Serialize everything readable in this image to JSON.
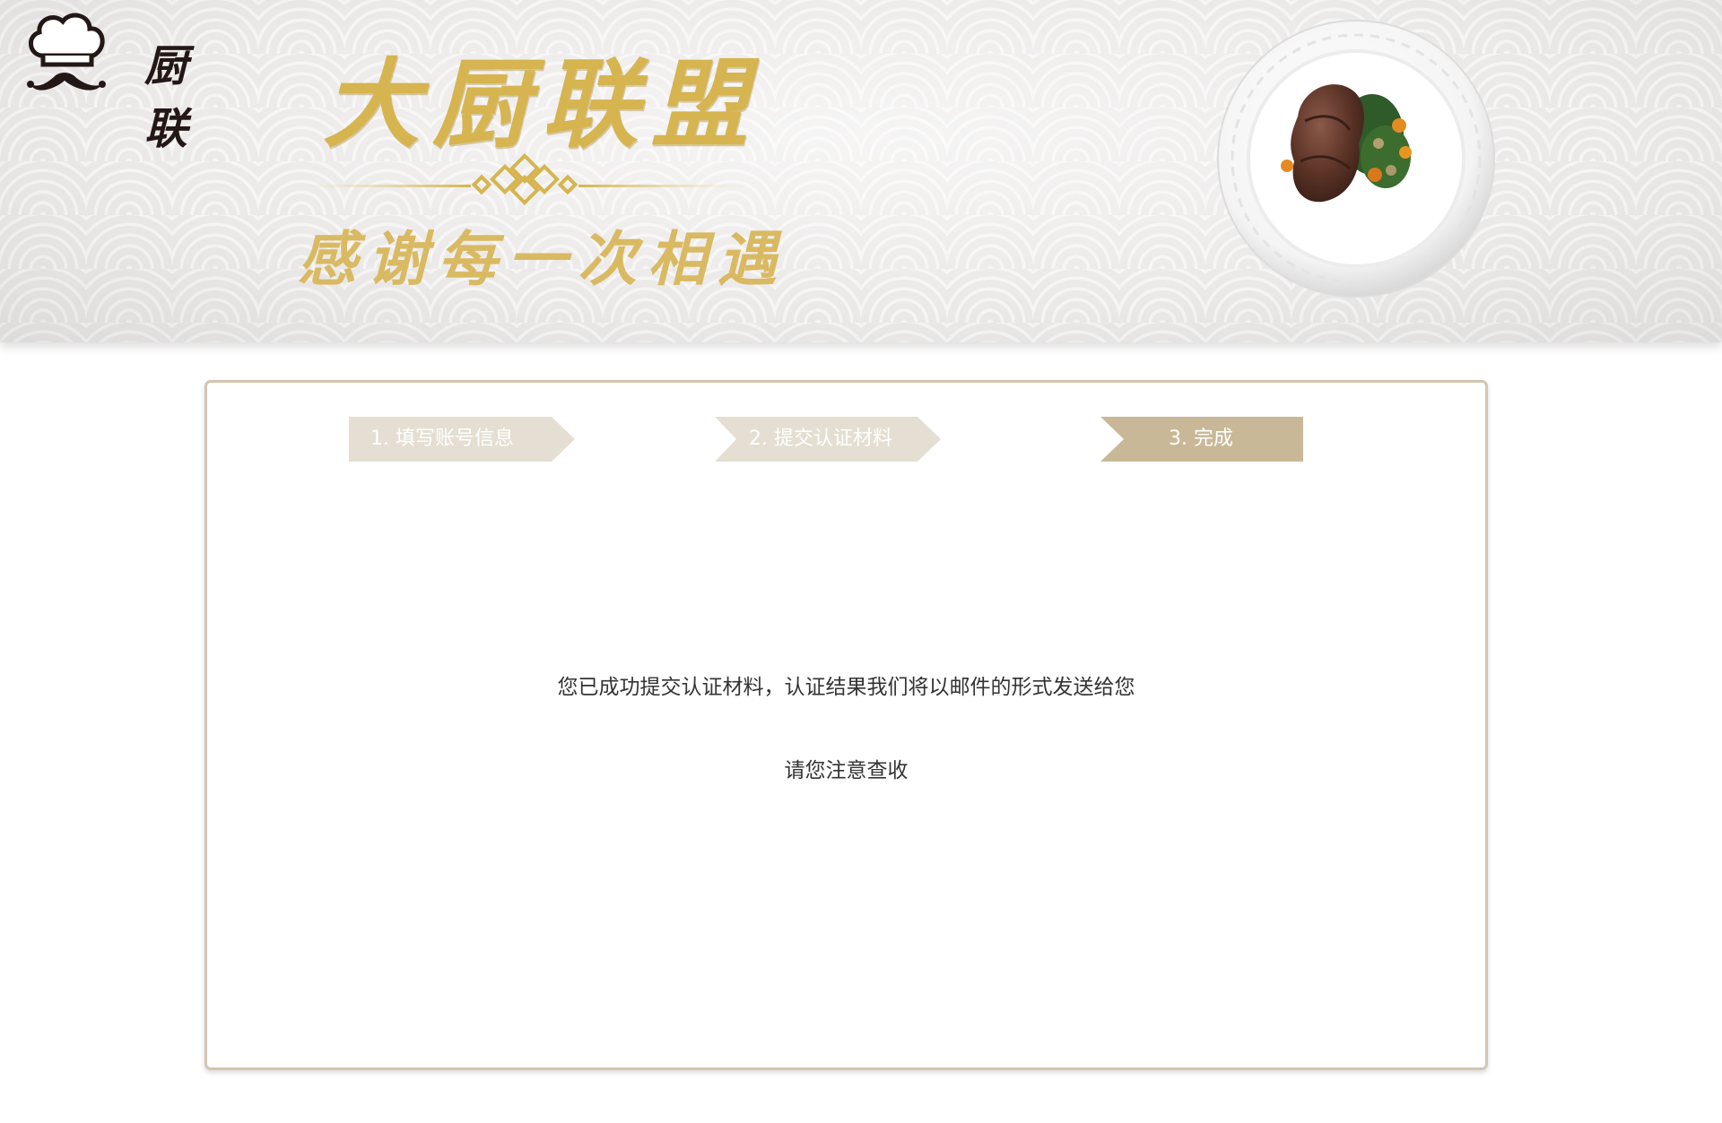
{
  "header": {
    "logo_text": "厨联",
    "slogan_main": "大厨联盟",
    "slogan_sub": "感谢每一次相遇",
    "colors": {
      "gold": "#d6b44f",
      "logo_dark": "#231815"
    }
  },
  "steps": [
    {
      "label": "1. 填写账号信息",
      "state": "done",
      "color": "#e4dfd2"
    },
    {
      "label": "2. 提交认证材料",
      "state": "done",
      "color": "#e4dfd2"
    },
    {
      "label": "3. 完成",
      "state": "active",
      "color": "#c9b897"
    }
  ],
  "message": {
    "line1": "您已成功提交认证材料，认证结果我们将以邮件的形式发送给您",
    "line2": "请您注意查收"
  },
  "icons": [
    "chef-hat-mustache-icon",
    "ornament-knot-icon",
    "steak-plate-image"
  ]
}
